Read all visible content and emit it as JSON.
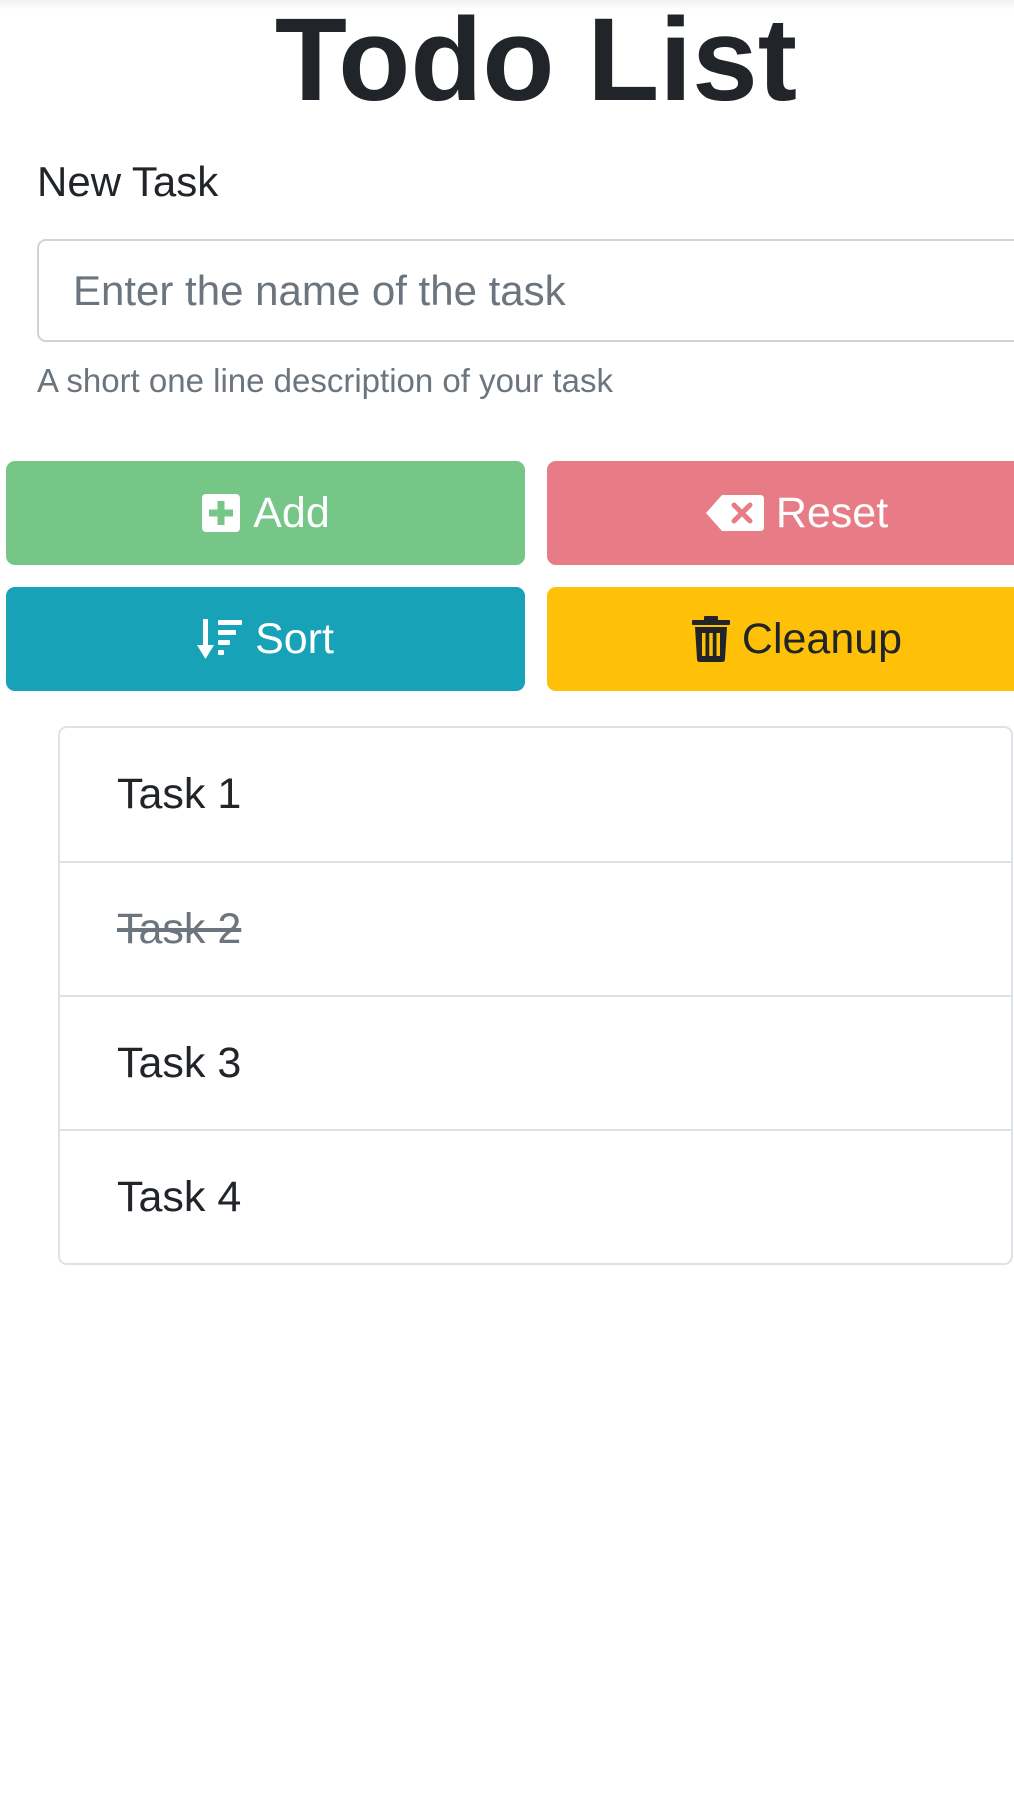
{
  "header": {
    "title": "Todo List"
  },
  "form": {
    "label": "New Task",
    "input_value": "",
    "input_placeholder": "Enter the name of the task",
    "help_text": "A short one line description of your task"
  },
  "buttons": {
    "add": {
      "label": "Add",
      "icon": "plus-square-icon",
      "color": "#75c687"
    },
    "reset": {
      "label": "Reset",
      "icon": "backspace-icon",
      "color": "#e87c86"
    },
    "sort": {
      "label": "Sort",
      "icon": "sort-amount-down-icon",
      "color": "#17a2b8"
    },
    "cleanup": {
      "label": "Cleanup",
      "icon": "trash-icon",
      "color": "#ffc107"
    }
  },
  "tasks": [
    {
      "label": "Task 1",
      "done": false
    },
    {
      "label": "Task 2",
      "done": true
    },
    {
      "label": "Task 3",
      "done": false
    },
    {
      "label": "Task 4",
      "done": false
    }
  ]
}
